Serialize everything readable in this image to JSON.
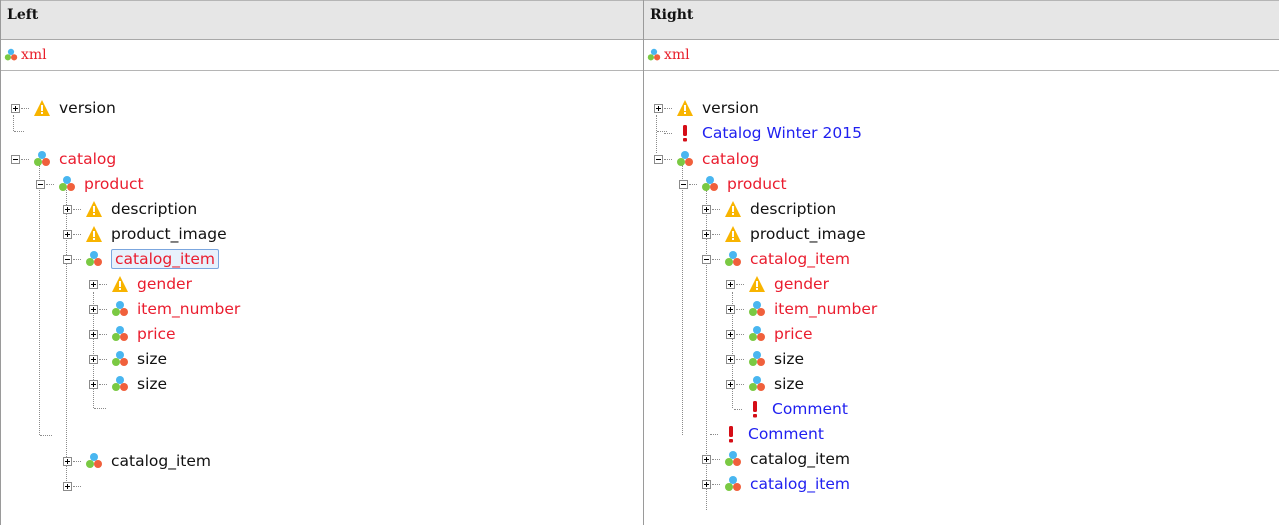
{
  "left": {
    "header": "Left",
    "root": "xml",
    "nodes": [
      {
        "label": "version",
        "icon": "warning-icon",
        "color": "black",
        "expander": "plus"
      },
      {
        "label": "catalog",
        "icon": "element-icon",
        "color": "red",
        "expander": "minus"
      },
      {
        "label": "product",
        "icon": "element-icon",
        "color": "red",
        "expander": "minus"
      },
      {
        "label": "description",
        "icon": "warning-icon",
        "color": "black",
        "expander": "plus"
      },
      {
        "label": "product_image",
        "icon": "warning-icon",
        "color": "black",
        "expander": "plus"
      },
      {
        "label": "catalog_item",
        "icon": "element-icon",
        "color": "red",
        "expander": "minus",
        "selected": true
      },
      {
        "label": "gender",
        "icon": "warning-icon",
        "color": "red",
        "expander": "plus"
      },
      {
        "label": "item_number",
        "icon": "element-icon",
        "color": "red",
        "expander": "plus"
      },
      {
        "label": "price",
        "icon": "element-icon",
        "color": "red",
        "expander": "plus"
      },
      {
        "label": "size",
        "icon": "element-icon",
        "color": "black",
        "expander": "plus"
      },
      {
        "label": "size",
        "icon": "element-icon",
        "color": "black",
        "expander": "plus"
      },
      {
        "label": "catalog_item",
        "icon": "element-icon",
        "color": "black",
        "expander": "plus"
      }
    ]
  },
  "right": {
    "header": "Right",
    "root": "xml",
    "nodes": [
      {
        "label": "version",
        "icon": "warning-icon",
        "color": "black",
        "expander": "plus"
      },
      {
        "label": "Catalog Winter 2015",
        "icon": "exclamation-icon",
        "color": "blue",
        "expander": "none"
      },
      {
        "label": "catalog",
        "icon": "element-icon",
        "color": "red",
        "expander": "minus"
      },
      {
        "label": "product",
        "icon": "element-icon",
        "color": "red",
        "expander": "minus"
      },
      {
        "label": "description",
        "icon": "warning-icon",
        "color": "black",
        "expander": "plus"
      },
      {
        "label": "product_image",
        "icon": "warning-icon",
        "color": "black",
        "expander": "plus"
      },
      {
        "label": "catalog_item",
        "icon": "element-icon",
        "color": "red",
        "expander": "minus"
      },
      {
        "label": "gender",
        "icon": "warning-icon",
        "color": "red",
        "expander": "plus"
      },
      {
        "label": "item_number",
        "icon": "element-icon",
        "color": "red",
        "expander": "plus"
      },
      {
        "label": "price",
        "icon": "element-icon",
        "color": "red",
        "expander": "plus"
      },
      {
        "label": "size",
        "icon": "element-icon",
        "color": "black",
        "expander": "plus"
      },
      {
        "label": "size",
        "icon": "element-icon",
        "color": "black",
        "expander": "plus"
      },
      {
        "label": "Comment",
        "icon": "exclamation-icon",
        "color": "blue",
        "expander": "none"
      },
      {
        "label": "Comment",
        "icon": "exclamation-icon",
        "color": "blue",
        "expander": "none"
      },
      {
        "label": "catalog_item",
        "icon": "element-icon",
        "color": "black",
        "expander": "plus"
      },
      {
        "label": "catalog_item",
        "icon": "element-icon",
        "color": "blue",
        "expander": "plus"
      }
    ]
  }
}
